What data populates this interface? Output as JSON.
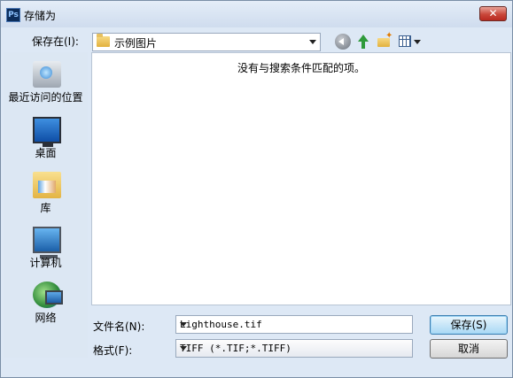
{
  "window": {
    "app_icon": "Ps",
    "title": "存储为",
    "close_glyph": "✕"
  },
  "location": {
    "label": "保存在(I):",
    "value": "示例图片"
  },
  "toolbar": {
    "icons": [
      "back-icon",
      "up-folder-icon",
      "new-folder-icon",
      "view-menu-icon"
    ]
  },
  "places": [
    {
      "label": "最近访问的位置",
      "icon": "recent-places-icon"
    },
    {
      "label": "桌面",
      "icon": "desktop-icon"
    },
    {
      "label": "库",
      "icon": "libraries-icon"
    },
    {
      "label": "计算机",
      "icon": "computer-icon"
    },
    {
      "label": "网络",
      "icon": "network-icon"
    }
  ],
  "filelist": {
    "empty_message": "没有与搜索条件匹配的项。"
  },
  "filename": {
    "label": "文件名(N):",
    "value": "Lighthouse.tif"
  },
  "format": {
    "label": "格式(F):",
    "value": "TIFF (*.TIF;*.TIFF)"
  },
  "buttons": {
    "save": "保存(S)",
    "cancel": "取消"
  }
}
